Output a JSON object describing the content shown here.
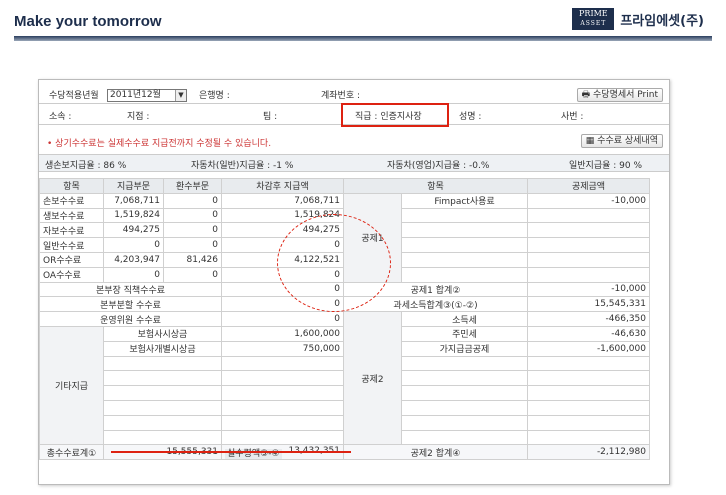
{
  "header": {
    "title": "Make your tomorrow",
    "logo_line1": "PRIME",
    "logo_line2": "ASSET",
    "logo_text": "프라임에셋(주)"
  },
  "filter": {
    "month_label": "수당적용년월",
    "month_value": "2011년12월",
    "bank_label": "은행명 :",
    "account_label": "계좌번호 :",
    "print_button": "수당명세서 Print",
    "dept_label": "소속 :",
    "branch_label": "지점 :",
    "team_label": "팀 :",
    "position_label": "직급 : 인증지사장",
    "name_label": "성명 :",
    "id_label": "사번 :"
  },
  "notice": "• 상기수수료는 실제수수료 지급전까지 수정될 수 있습니다.",
  "detail_button": "수수료 상세내역",
  "rates": [
    "생손보지급율 : 86 %",
    "자동차(일반)지급율 : -1  %",
    "자동차(영업)지급율 : -0.%",
    "일반지급율 : 90 %"
  ],
  "table": {
    "headers": [
      "항목",
      "지급부문",
      "환수부문",
      "차감후 지급액",
      "항목",
      "공제금액"
    ],
    "rows": [
      {
        "item": "손보수수료",
        "pay": "7,068,711",
        "refund": "0",
        "net": "7,068,711"
      },
      {
        "item": "생보수수료",
        "pay": "1,519,824",
        "refund": "0",
        "net": "1,519,824"
      },
      {
        "item": "자보수수료",
        "pay": "494,275",
        "refund": "0",
        "net": "494,275"
      },
      {
        "item": "일반수수료",
        "pay": "0",
        "refund": "0",
        "net": "0"
      },
      {
        "item": "OR수수료",
        "pay": "4,203,947",
        "refund": "81,426",
        "net": "4,122,521"
      },
      {
        "item": "OA수수료",
        "pay": "0",
        "refund": "0",
        "net": "0"
      }
    ],
    "extra_rows": [
      {
        "item": "본부장 직책수수료",
        "net": "0"
      },
      {
        "item": "본부분할 수수료",
        "net": "0"
      },
      {
        "item": "운영위원 수수료",
        "net": "0"
      }
    ],
    "other_label": "기타지급",
    "other_rows": [
      {
        "item": "보험사시상금",
        "net": "1,600,000"
      },
      {
        "item": "보험사개별시상금",
        "net": "750,000"
      }
    ],
    "ded1_label": "공제1",
    "ded1_first": {
      "item": "Fimpact사용료",
      "amount": "-10,000"
    },
    "ded1_total": {
      "item": "공제1 합계②",
      "amount": "-10,000"
    },
    "taxable": {
      "item": "과세소득합계③(①-②)",
      "amount": "15,545,331"
    },
    "ded2_label": "공제2",
    "ded2_rows": [
      {
        "item": "소득세",
        "amount": "-466,350"
      },
      {
        "item": "주민세",
        "amount": "-46,630"
      },
      {
        "item": "가지급금공제",
        "amount": "-1,600,000"
      }
    ],
    "footer": {
      "total_label": "총수수료계①",
      "total_value": "15,555,331",
      "actual_label": "실수령액③-④",
      "actual_value": "13,432,351",
      "ded2_total_label": "공제2 합계④",
      "ded2_total_value": "-2,112,980"
    }
  }
}
